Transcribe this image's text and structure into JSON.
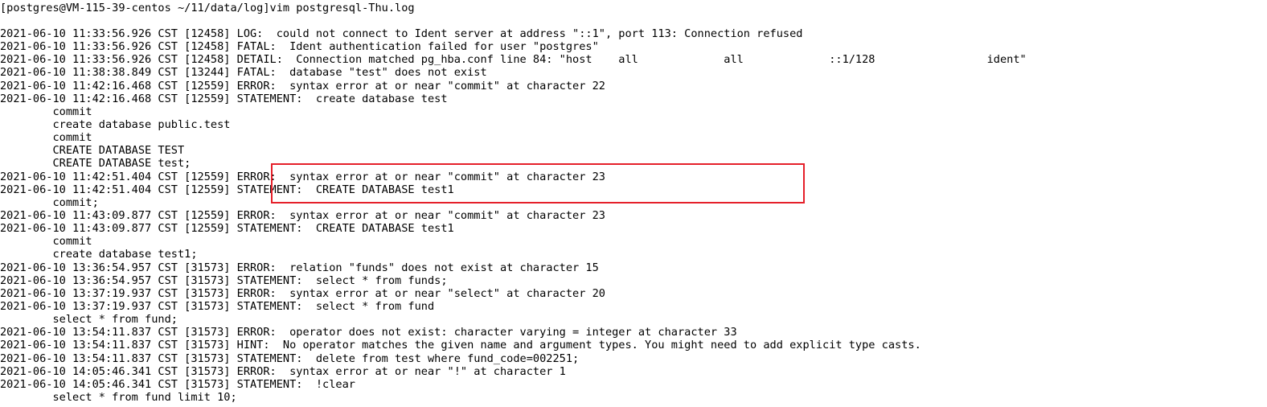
{
  "terminal": {
    "prompt_line": "[postgres@VM-115-39-centos ~/11/data/log]vim postgresql-Thu.log",
    "highlight_color": "#e5202a",
    "lines": [
      "2021-06-10 11:33:56.926 CST [12458] LOG:  could not connect to Ident server at address \"::1\", port 113: Connection refused",
      "2021-06-10 11:33:56.926 CST [12458] FATAL:  Ident authentication failed for user \"postgres\"",
      "2021-06-10 11:33:56.926 CST [12458] DETAIL:  Connection matched pg_hba.conf line 84: \"host    all             all             ::1/128                 ident\"",
      "2021-06-10 11:38:38.849 CST [13244] FATAL:  database \"test\" does not exist",
      "2021-06-10 11:42:16.468 CST [12559] ERROR:  syntax error at or near \"commit\" at character 22",
      "2021-06-10 11:42:16.468 CST [12559] STATEMENT:  create database test",
      "        commit",
      "        create database public.test",
      "        commit",
      "        CREATE DATABASE TEST",
      "        CREATE DATABASE test;",
      "2021-06-10 11:42:51.404 CST [12559] ERROR:  syntax error at or near \"commit\" at character 23",
      "2021-06-10 11:42:51.404 CST [12559] STATEMENT:  CREATE DATABASE test1",
      "        commit;",
      "2021-06-10 11:43:09.877 CST [12559] ERROR:  syntax error at or near \"commit\" at character 23",
      "2021-06-10 11:43:09.877 CST [12559] STATEMENT:  CREATE DATABASE test1",
      "        commit",
      "        create database test1;",
      "2021-06-10 13:36:54.957 CST [31573] ERROR:  relation \"funds\" does not exist at character 15",
      "2021-06-10 13:36:54.957 CST [31573] STATEMENT:  select * from funds;",
      "2021-06-10 13:37:19.937 CST [31573] ERROR:  syntax error at or near \"select\" at character 20",
      "2021-06-10 13:37:19.937 CST [31573] STATEMENT:  select * from fund",
      "        select * from fund;",
      "2021-06-10 13:54:11.837 CST [31573] ERROR:  operator does not exist: character varying = integer at character 33",
      "2021-06-10 13:54:11.837 CST [31573] HINT:  No operator matches the given name and argument types. You might need to add explicit type casts.",
      "2021-06-10 13:54:11.837 CST [31573] STATEMENT:  delete from test where fund_code=002251;",
      "2021-06-10 14:05:46.341 CST [31573] ERROR:  syntax error at or near \"!\" at character 1",
      "2021-06-10 14:05:46.341 CST [31573] STATEMENT:  !clear",
      "        select * from fund limit 10;"
    ]
  }
}
